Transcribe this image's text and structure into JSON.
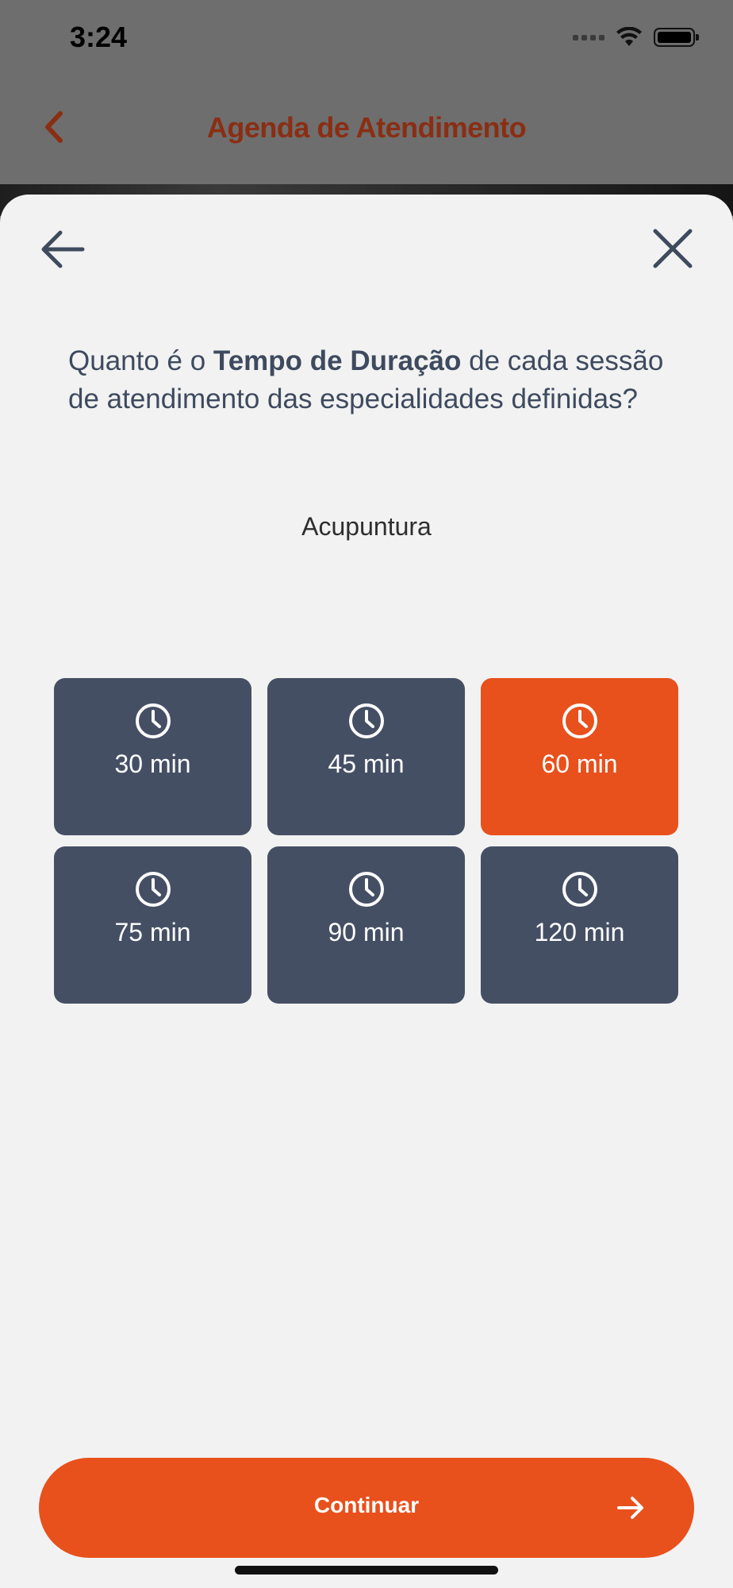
{
  "status_bar": {
    "time": "3:24"
  },
  "header": {
    "title": "Agenda de Atendimento",
    "back_icon": "chevron-left-icon"
  },
  "sheet": {
    "back_icon": "arrow-left-icon",
    "close_icon": "close-icon",
    "question": {
      "prefix": "Quanto é o ",
      "emphasis": "Tempo de Duração",
      "suffix": " de cada sessão de atendimento das especialidades definidas?"
    },
    "specialty": "Acupuntura",
    "options": [
      {
        "label": "30 min",
        "icon": "clock-icon",
        "selected": false
      },
      {
        "label": "45 min",
        "icon": "clock-icon",
        "selected": false
      },
      {
        "label": "60 min",
        "icon": "clock-icon",
        "selected": true
      },
      {
        "label": "75 min",
        "icon": "clock-icon",
        "selected": false
      },
      {
        "label": "90 min",
        "icon": "clock-icon",
        "selected": false
      },
      {
        "label": "120 min",
        "icon": "clock-icon",
        "selected": false
      }
    ]
  },
  "footer": {
    "continue_label": "Continuar",
    "continue_icon": "arrow-right-icon"
  },
  "colors": {
    "accent": "#e8501c",
    "tile": "#454f64",
    "text_primary": "#3e4a5e",
    "header_title": "#8a2e13",
    "sheet_bg": "#f2f2f2"
  }
}
